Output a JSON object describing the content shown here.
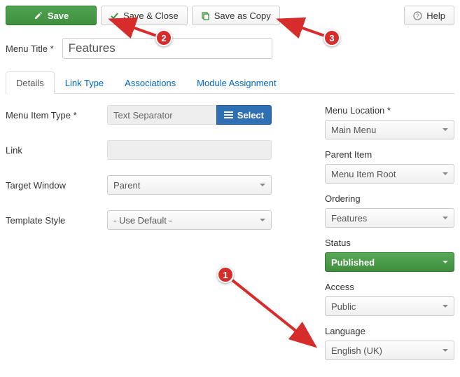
{
  "toolbar": {
    "save": "Save",
    "save_close": "Save & Close",
    "save_copy": "Save as Copy",
    "help": "Help"
  },
  "title": {
    "label": "Menu Title *",
    "value": "Features"
  },
  "tabs": [
    "Details",
    "Link Type",
    "Associations",
    "Module Assignment"
  ],
  "left": {
    "menu_item_type": {
      "label": "Menu Item Type *",
      "value": "Text Separator",
      "select_btn": "Select"
    },
    "link": {
      "label": "Link",
      "value": ""
    },
    "target_window": {
      "label": "Target Window",
      "value": "Parent"
    },
    "template_style": {
      "label": "Template Style",
      "value": "- Use Default -"
    }
  },
  "right": {
    "menu_location": {
      "label": "Menu Location *",
      "value": "Main Menu"
    },
    "parent_item": {
      "label": "Parent Item",
      "value": "Menu Item Root"
    },
    "ordering": {
      "label": "Ordering",
      "value": "Features"
    },
    "status": {
      "label": "Status",
      "value": "Published"
    },
    "access": {
      "label": "Access",
      "value": "Public"
    },
    "language": {
      "label": "Language",
      "value": "English (UK)"
    }
  },
  "annotations": {
    "n1": "1",
    "n2": "2",
    "n3": "3"
  }
}
